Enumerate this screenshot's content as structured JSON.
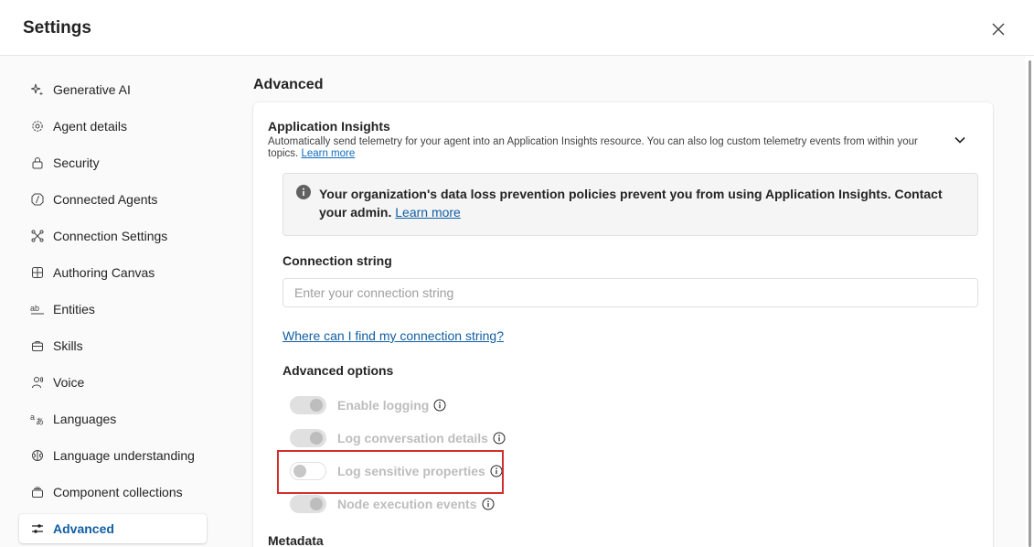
{
  "header": {
    "title": "Settings"
  },
  "sidebar": {
    "items": [
      {
        "label": "Generative AI",
        "icon": "sparkle-icon"
      },
      {
        "label": "Agent details",
        "icon": "gear-icon"
      },
      {
        "label": "Security",
        "icon": "lock-icon"
      },
      {
        "label": "Connected Agents",
        "icon": "connected-agents-icon"
      },
      {
        "label": "Connection Settings",
        "icon": "connection-icon"
      },
      {
        "label": "Authoring Canvas",
        "icon": "grid-icon"
      },
      {
        "label": "Entities",
        "icon": "entities-icon"
      },
      {
        "label": "Skills",
        "icon": "briefcase-icon"
      },
      {
        "label": "Voice",
        "icon": "voice-icon"
      },
      {
        "label": "Languages",
        "icon": "translate-icon"
      },
      {
        "label": "Language understanding",
        "icon": "brain-icon"
      },
      {
        "label": "Component collections",
        "icon": "collection-icon"
      },
      {
        "label": "Advanced",
        "icon": "sliders-icon",
        "active": true
      }
    ]
  },
  "main": {
    "section_title": "Advanced",
    "app_insights": {
      "title": "Application Insights",
      "description": "Automatically send telemetry for your agent into an Application Insights resource. You can also log custom telemetry events from within your topics.",
      "learn_more": "Learn more"
    },
    "warning": {
      "text": "Your organization's data loss prevention policies prevent you from using Application Insights. Contact your admin.",
      "link": "Learn more"
    },
    "connection": {
      "label": "Connection string",
      "placeholder": "Enter your connection string",
      "help_link": "Where can I find my connection string?"
    },
    "advanced_options": {
      "label": "Advanced options",
      "toggles": [
        {
          "label": "Enable logging",
          "state": "on"
        },
        {
          "label": "Log conversation details",
          "state": "on"
        },
        {
          "label": "Log sensitive properties",
          "state": "off"
        },
        {
          "label": "Node execution events",
          "state": "on"
        }
      ]
    },
    "metadata_label": "Metadata"
  },
  "colors": {
    "accent": "#115ea3",
    "link": "#0f6cbd",
    "highlight": "#d32f2f",
    "disabled_text": "#bdbdbd"
  }
}
